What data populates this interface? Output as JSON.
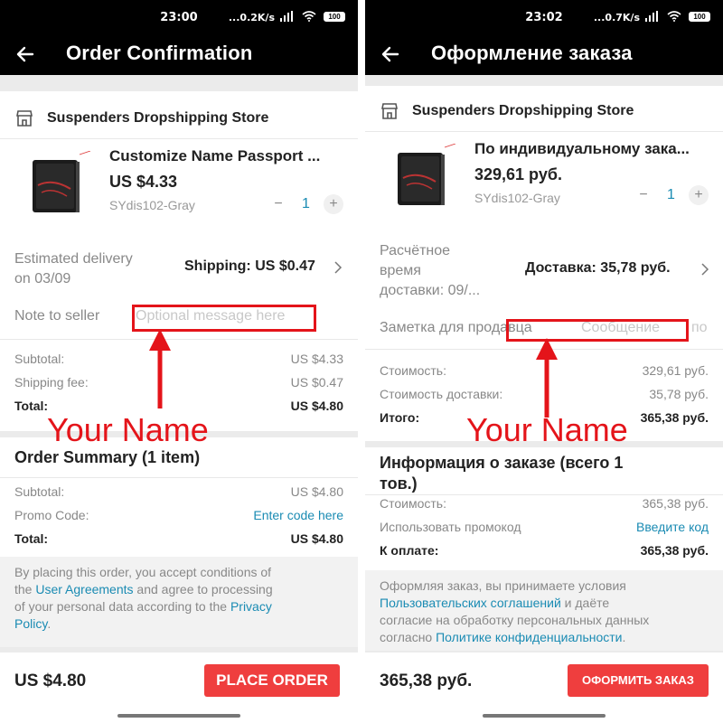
{
  "colors": {
    "accent": "#ef3e3e",
    "link": "#1a8bb3",
    "annotation": "#e4141a"
  },
  "left": {
    "status": {
      "time": "23:00",
      "net": "...0.2K/s",
      "battery": "100"
    },
    "header": {
      "title": "Order Confirmation"
    },
    "store": {
      "name": "Suspenders Dropshipping Store"
    },
    "product": {
      "title": "Customize Name Passport ...",
      "price": "US $4.33",
      "sku": "SYdis102-Gray",
      "qty": "1",
      "minus": "−",
      "plus": "+"
    },
    "delivery": {
      "label": "Estimated delivery on 03/09",
      "label_line1": "Estimated delivery",
      "label_line2": "on 03/09",
      "shipping": "Shipping: US $0.47"
    },
    "note": {
      "label": "Note to seller",
      "placeholder": "Optional message here"
    },
    "costs": [
      {
        "label": "Subtotal:",
        "value": "US $4.33"
      },
      {
        "label": "Shipping fee:",
        "value": "US $0.47"
      },
      {
        "label": "Total:",
        "value": "US $4.80"
      }
    ],
    "annotation": "Your Name",
    "summary": {
      "title": "Order Summary (1 item)",
      "rows": [
        {
          "label": "Subtotal:",
          "value": "US $4.80"
        },
        {
          "label": "Promo Code:",
          "value": "Enter code here"
        },
        {
          "label": "Total:",
          "value": "US $4.80"
        }
      ]
    },
    "legal": {
      "p1": "By placing this order, you accept conditions of",
      "p2": "the ",
      "link1": "User Agreements",
      "p3": " and agree to processing",
      "p4": "of your personal data according to the ",
      "link2": "Privacy",
      "link3": "Policy",
      "p5": "."
    },
    "bottom": {
      "total": "US $4.80",
      "button": "PLACE ORDER"
    }
  },
  "right": {
    "status": {
      "time": "23:02",
      "net": "...0.7K/s",
      "battery": "100"
    },
    "header": {
      "title": "Оформление заказа"
    },
    "store": {
      "name": "Suspenders Dropshipping Store"
    },
    "product": {
      "title": "По индивидуальному зака...",
      "price": "329,61 руб.",
      "sku": "SYdis102-Gray",
      "qty": "1",
      "minus": "−",
      "plus": "+"
    },
    "delivery": {
      "line1": "Расчётное",
      "line2": "время",
      "line3": "доставки: 09/...",
      "shipping": "Доставка: 35,78 руб."
    },
    "note": {
      "label": "Заметка для продавца",
      "placeholder": "Сообщение",
      "tail": "по"
    },
    "costs": [
      {
        "label": "Стоимость:",
        "value": "329,61 руб."
      },
      {
        "label": "Стоимость доставки:",
        "value": "35,78 руб."
      },
      {
        "label": "Итого:",
        "value": "365,38 руб."
      }
    ],
    "annotation": "Your Name",
    "summary": {
      "title_line1": "Информация о заказе (всего 1",
      "title_line2": "тов.)",
      "rows": [
        {
          "label": "Стоимость:",
          "value": "365,38 руб."
        },
        {
          "label": "Использовать промокод",
          "value": "Введите код"
        },
        {
          "label": "К оплате:",
          "value": "365,38 руб."
        }
      ]
    },
    "legal": {
      "p1": "Оформляя заказ, вы принимаете условия",
      "link1": "Пользовательских соглашений",
      "p2": " и даёте",
      "p3": "согласие на обработку персональных данных",
      "p4": "согласно ",
      "link2": "Политике конфиденциальности",
      "p5": "."
    },
    "bottom": {
      "total": "365,38 руб.",
      "button": "ОФОРМИТЬ ЗАКАЗ"
    }
  }
}
